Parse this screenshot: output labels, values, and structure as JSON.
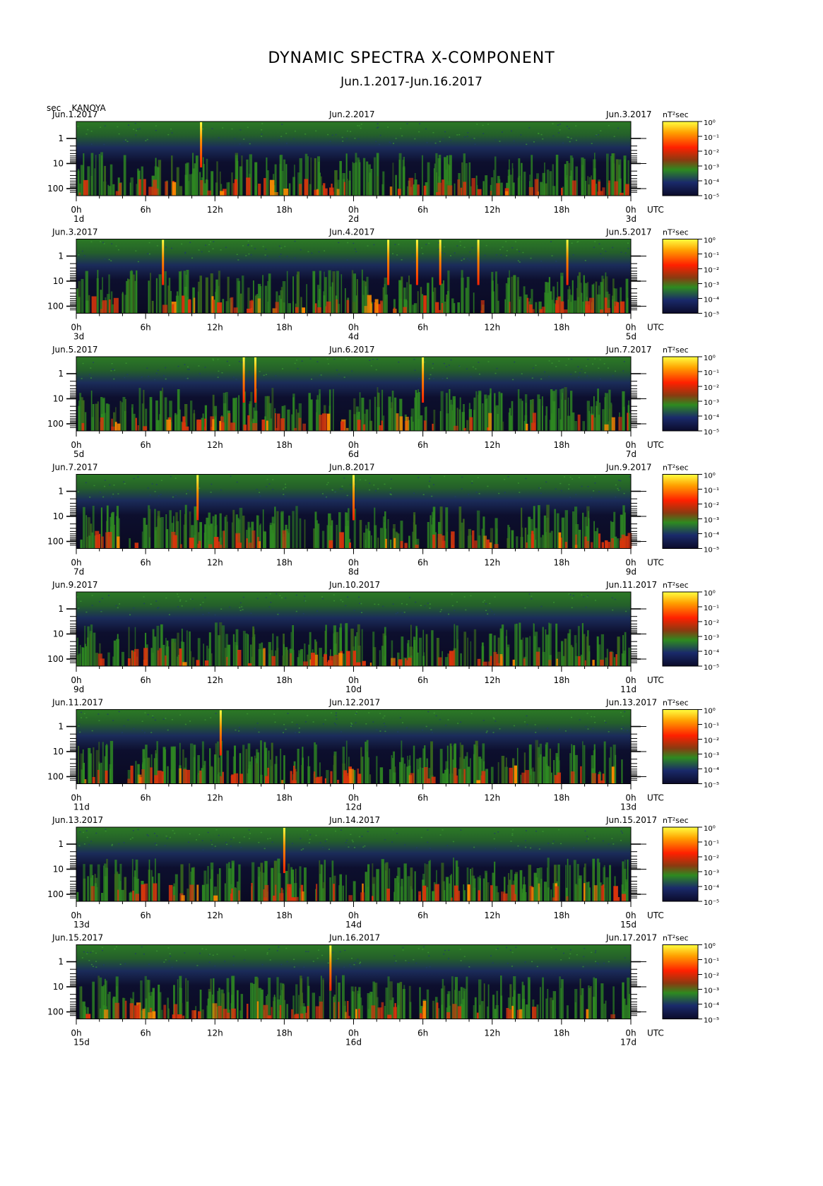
{
  "header": {
    "title": "DYNAMIC SPECTRA X-COMPONENT",
    "subtitle": "Jun.1.2017-Jun.16.2017",
    "period_unit": "sec",
    "station": "KANOYA"
  },
  "colors": {
    "scale": [
      "#0b0b2a",
      "#1a2a6a",
      "#2f7f1f",
      "#3aa028",
      "#c83a10",
      "#ff2000",
      "#ff8a00",
      "#ffff40"
    ]
  },
  "chart_data": {
    "type": "heatmap",
    "x_ticks": [
      "0h",
      "6h",
      "12h",
      "18h",
      "0h",
      "6h",
      "12h",
      "18h",
      "0h"
    ],
    "x_unit": "UTC",
    "y_ticks": [
      "1",
      "10",
      "100"
    ],
    "y_scale": "log",
    "colorbar_unit": "nT²sec",
    "colorbar_ticks": [
      "10⁰",
      "10⁻¹",
      "10⁻²",
      "10⁻³",
      "10⁻⁴",
      "10⁻⁵"
    ],
    "panels": [
      {
        "date_left": "Jun.1.2017",
        "date_mid": "Jun.2.2017",
        "date_right": "Jun.3.2017",
        "day_left": "1d",
        "day_mid": "2d",
        "day_right": "3d",
        "spikes": [
          10.8
        ]
      },
      {
        "date_left": "Jun.3.2017",
        "date_mid": "Jun.4.2017",
        "date_right": "Jun.5.2017",
        "day_left": "3d",
        "day_mid": "4d",
        "day_right": "5d",
        "spikes": [
          7.5,
          3.0,
          5.5,
          7.5,
          10.8,
          18.5
        ]
      },
      {
        "date_left": "Jun.5.2017",
        "date_mid": "Jun.6.2017",
        "date_right": "Jun.7.2017",
        "day_left": "5d",
        "day_mid": "6d",
        "day_right": "7d",
        "spikes": [
          14.5,
          15.5,
          6.0
        ]
      },
      {
        "date_left": "Jun.7.2017",
        "date_mid": "Jun.8.2017",
        "date_right": "Jun.9.2017",
        "day_left": "7d",
        "day_mid": "8d",
        "day_right": "9d",
        "spikes": [
          10.5,
          0.0
        ]
      },
      {
        "date_left": "Jun.9.2017",
        "date_mid": "Jun.10.2017",
        "date_right": "Jun.11.2017",
        "day_left": "9d",
        "day_mid": "10d",
        "day_right": "11d",
        "spikes": []
      },
      {
        "date_left": "Jun.11.2017",
        "date_mid": "Jun.12.2017",
        "date_right": "Jun.13.2017",
        "day_left": "11d",
        "day_mid": "12d",
        "day_right": "13d",
        "spikes": [
          12.5
        ]
      },
      {
        "date_left": "Jun.13.2017",
        "date_mid": "Jun.14.2017",
        "date_right": "Jun.15.2017",
        "day_left": "13d",
        "day_mid": "14d",
        "day_right": "15d",
        "spikes": [
          18.0
        ]
      },
      {
        "date_left": "Jun.15.2017",
        "date_mid": "Jun.16.2017",
        "date_right": "Jun.17.2017",
        "day_left": "15d",
        "day_mid": "16d",
        "day_right": "17d",
        "spikes": [
          22.0
        ]
      }
    ]
  }
}
